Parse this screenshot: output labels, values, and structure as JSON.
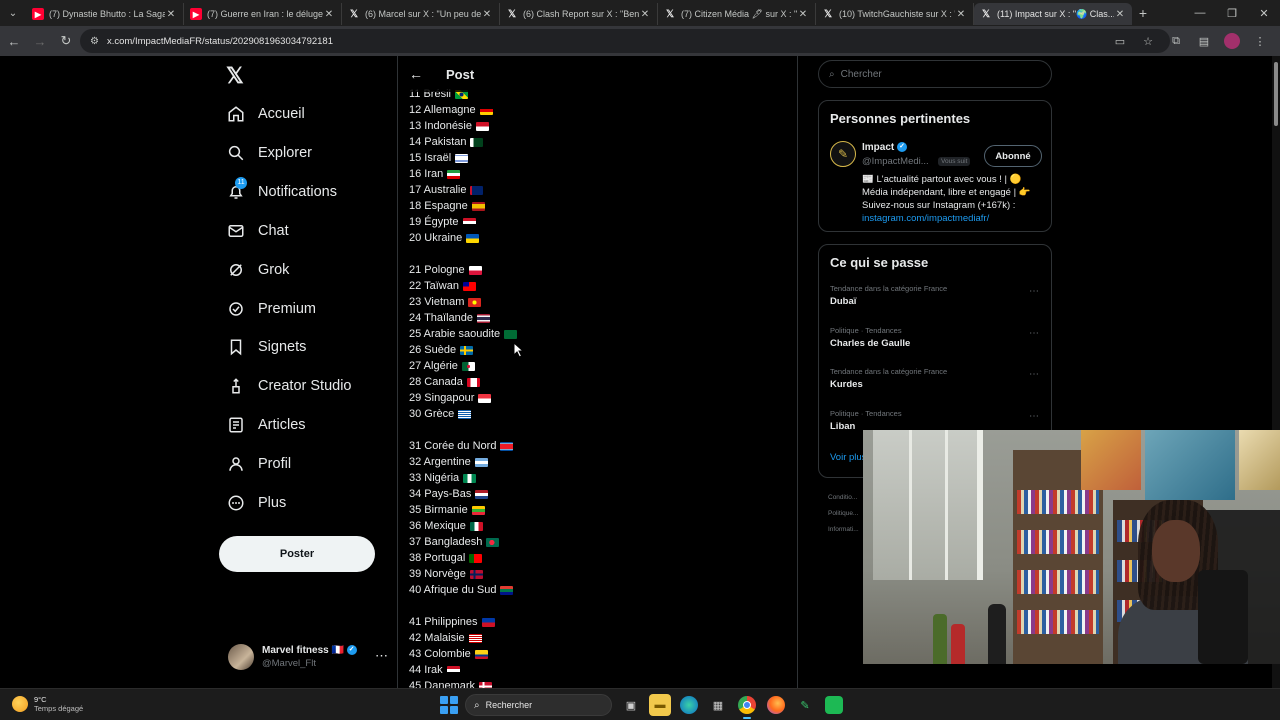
{
  "browser": {
    "tabs": [
      {
        "label": "(7) Dynastie Bhutto : La Saga S...",
        "favicon": "youtube-icon",
        "active": false
      },
      {
        "label": "(7) Guerre en Iran : le déluge de...",
        "favicon": "youtube-icon",
        "active": false
      },
      {
        "label": "(6) Marcel sur X : \"Un peu de je...",
        "favicon": "x-icon",
        "active": false
      },
      {
        "label": "(6) Clash Report sur X : \"Benne...",
        "favicon": "x-icon",
        "active": false
      },
      {
        "label": "(7) Citizen Média 🖋 sur X : \"re...",
        "favicon": "x-icon",
        "active": false
      },
      {
        "label": "(10) TwitchGauchiste sur X : \"... ",
        "favicon": "x-icon",
        "active": false
      },
      {
        "label": "(11) Impact sur X : \"🌍 Clas...",
        "favicon": "x-icon",
        "active": true
      }
    ],
    "url": "x.com/ImpactMediaFR/status/2029081963034792181"
  },
  "nav": {
    "items": [
      {
        "label": "Accueil",
        "icon": "home-icon"
      },
      {
        "label": "Explorer",
        "icon": "search-icon"
      },
      {
        "label": "Notifications",
        "icon": "bell-icon",
        "badge": "11"
      },
      {
        "label": "Chat",
        "icon": "mail-icon"
      },
      {
        "label": "Grok",
        "icon": "grok-icon"
      },
      {
        "label": "Premium",
        "icon": "verified-icon"
      },
      {
        "label": "Signets",
        "icon": "bookmark-icon"
      },
      {
        "label": "Creator Studio",
        "icon": "creator-icon"
      },
      {
        "label": "Articles",
        "icon": "article-icon"
      },
      {
        "label": "Profil",
        "icon": "person-icon"
      },
      {
        "label": "Plus",
        "icon": "more-circle-icon"
      }
    ],
    "post_button": "Poster",
    "account": {
      "name": "Marvel fitness 🇫🇷",
      "handle": "@Marvel_Flt"
    }
  },
  "post": {
    "header_title": "Post",
    "lines": [
      {
        "text": "11 Brésil",
        "flag": "br"
      },
      {
        "text": "12 Allemagne",
        "flag": "de"
      },
      {
        "text": "13 Indonésie",
        "flag": "id"
      },
      {
        "text": "14 Pakistan",
        "flag": "pk"
      },
      {
        "text": "15 Israël",
        "flag": "il"
      },
      {
        "text": "16 Iran",
        "flag": "ir"
      },
      {
        "text": "17 Australie",
        "flag": "au"
      },
      {
        "text": "18 Espagne",
        "flag": "es"
      },
      {
        "text": "19 Égypte",
        "flag": "eg"
      },
      {
        "text": "20 Ukraine",
        "flag": "ua"
      },
      {
        "text": "",
        "flag": ""
      },
      {
        "text": "21 Pologne",
        "flag": "pl"
      },
      {
        "text": "22 Taïwan",
        "flag": "tw"
      },
      {
        "text": "23 Vietnam",
        "flag": "vn"
      },
      {
        "text": "24 Thaïlande",
        "flag": "th"
      },
      {
        "text": "25 Arabie saoudite",
        "flag": "sa"
      },
      {
        "text": "26 Suède",
        "flag": "se"
      },
      {
        "text": "27 Algérie",
        "flag": "dz"
      },
      {
        "text": "28 Canada",
        "flag": "ca"
      },
      {
        "text": "29 Singapour",
        "flag": "sg"
      },
      {
        "text": "30 Grèce",
        "flag": "gr"
      },
      {
        "text": "",
        "flag": ""
      },
      {
        "text": "31 Corée du Nord",
        "flag": "kp"
      },
      {
        "text": "32 Argentine",
        "flag": "ar"
      },
      {
        "text": "33 Nigéria",
        "flag": "ng"
      },
      {
        "text": "34 Pays-Bas",
        "flag": "nl"
      },
      {
        "text": "35 Birmanie",
        "flag": "mm"
      },
      {
        "text": "36 Mexique",
        "flag": "mx"
      },
      {
        "text": "37 Bangladesh",
        "flag": "bd"
      },
      {
        "text": "38 Portugal",
        "flag": "pt"
      },
      {
        "text": "39 Norvège",
        "flag": "no"
      },
      {
        "text": "40 Afrique du Sud",
        "flag": "za"
      },
      {
        "text": "",
        "flag": ""
      },
      {
        "text": "41 Philippines",
        "flag": "ph"
      },
      {
        "text": "42 Malaisie",
        "flag": "my"
      },
      {
        "text": "43 Colombie",
        "flag": "co"
      },
      {
        "text": "44 Irak",
        "flag": "iq"
      },
      {
        "text": "45 Danemark",
        "flag": "dk"
      }
    ]
  },
  "sidebar": {
    "search_placeholder": "Chercher",
    "relevant": {
      "title": "Personnes pertinentes",
      "name": "Impact",
      "handle": "@ImpactMedi...",
      "follows_you": "Vous suit",
      "follow_button": "Abonné",
      "bio": "📰 L'actualité partout avec vous ! | 🟡 Média indépendant, libre et engagé | 👉 Suivez-nous sur Instagram (+167k) :",
      "bio_link": "instagram.com/impactmediafr/"
    },
    "trends": {
      "title": "Ce qui se passe",
      "items": [
        {
          "meta": "Tendance dans la catégorie France",
          "name": "Dubaï"
        },
        {
          "meta": "Politique · Tendances",
          "name": "Charles de Gaulle"
        },
        {
          "meta": "Tendance dans la catégorie France",
          "name": "Kurdes"
        },
        {
          "meta": "Politique · Tendances",
          "name": "Liban"
        }
      ],
      "see_more": "Voir plus"
    },
    "footer_links": [
      "Conditio...",
      "Politique...",
      "Informati..."
    ]
  },
  "taskbar": {
    "temperature": "9°C",
    "weather": "Temps dégagé",
    "search_label": "Rechercher"
  },
  "colors": {
    "accent": "#1d9bf0",
    "background": "#000000",
    "border": "#2f3336"
  }
}
